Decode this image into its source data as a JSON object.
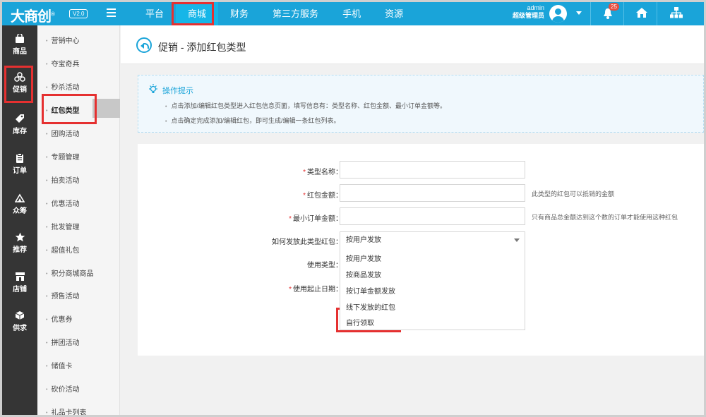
{
  "topbar": {
    "logo": "大商创",
    "logo_reg": "®",
    "version": "V2.0",
    "nav": [
      "平台",
      "商城",
      "财务",
      "第三方服务",
      "手机",
      "资源"
    ],
    "active_nav": "商城",
    "user_name": "admin",
    "user_role": "超级管理员",
    "notification_count": "25",
    "icons": [
      "menu-icon",
      "avatar",
      "chevron-down-icon",
      "bell-icon",
      "home-icon",
      "sitemap-icon"
    ]
  },
  "sidebar": [
    {
      "label": "商品",
      "icon": "bag-icon"
    },
    {
      "label": "促销",
      "icon": "promotion-icon",
      "active": true
    },
    {
      "label": "库存",
      "icon": "tag-icon"
    },
    {
      "label": "订单",
      "icon": "clipboard-icon"
    },
    {
      "label": "众筹",
      "icon": "crowdfund-icon"
    },
    {
      "label": "推荐",
      "icon": "star-icon"
    },
    {
      "label": "店铺",
      "icon": "shop-icon"
    },
    {
      "label": "供求",
      "icon": "cube-icon"
    }
  ],
  "subnav": [
    "营销中心",
    "夺宝奇兵",
    "秒杀活动",
    "红包类型",
    "团购活动",
    "专题管理",
    "拍卖活动",
    "优惠活动",
    "批发管理",
    "超值礼包",
    "积分商城商品",
    "预售活动",
    "优惠券",
    "拼团活动",
    "储值卡",
    "砍价活动",
    "礼品卡列表"
  ],
  "subnav_active": "红包类型",
  "page": {
    "title": "促销 - 添加红包类型",
    "tips_title": "操作提示",
    "tips": [
      "点击添加/编辑红包类型进入红包信息页面，填写信息有：类型名称、红包金额、最小订单金额等。",
      "点击确定完成添加/编辑红包，即可生成/编辑一条红包列表。"
    ]
  },
  "form": {
    "type_name_label": "类型名称：",
    "amount_label": "红包金额：",
    "amount_hint": "此类型的红包可以抵销的金额",
    "min_order_label": "最小订单金额：",
    "min_order_hint": "只有商品总金额达到这个数的订单才能使用这种红包",
    "send_method_label": "如何发放此类型红包：",
    "send_method_value": "按用户发放",
    "usage_type_label": "使用类型：",
    "date_label": "使用起止日期：",
    "required_mark": "*",
    "send_options": [
      "按用户发放",
      "按商品发放",
      "按订单金额发放",
      "线下发放的红包",
      "自行领取"
    ],
    "highlighted_option": "自行领取"
  },
  "colors": {
    "accent": "#1aa4d9",
    "highlight": "#e53030",
    "sidebar": "#353535"
  }
}
